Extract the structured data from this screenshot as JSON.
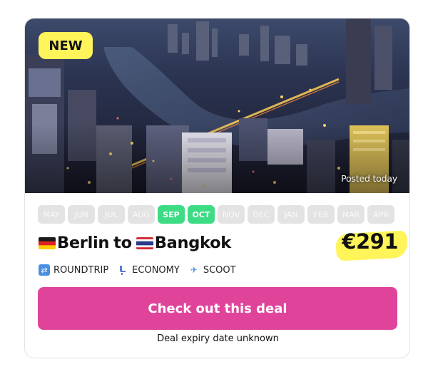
{
  "deal": {
    "badge": "NEW",
    "posted": "Posted today",
    "months": [
      {
        "label": "MAY",
        "active": false
      },
      {
        "label": "JUN",
        "active": false
      },
      {
        "label": "JUL",
        "active": false
      },
      {
        "label": "AUG",
        "active": false
      },
      {
        "label": "SEP",
        "active": true
      },
      {
        "label": "OCT",
        "active": true
      },
      {
        "label": "NOV",
        "active": false
      },
      {
        "label": "DEC",
        "active": false
      },
      {
        "label": "JAN",
        "active": false
      },
      {
        "label": "FEB",
        "active": false
      },
      {
        "label": "MAR",
        "active": false
      },
      {
        "label": "APR",
        "active": false
      }
    ],
    "origin": "Berlin",
    "connector": "to",
    "destination": "Bangkok",
    "origin_flag_icon": "germany-flag-icon",
    "destination_flag_icon": "thailand-flag-icon",
    "price": "€291",
    "tags": {
      "trip_type": "ROUNDTRIP",
      "cabin": "ECONOMY",
      "airline": "SCOOT"
    },
    "cta_label": "Check out this deal",
    "expiry": "Deal expiry date unknown"
  },
  "colors": {
    "badge_bg": "#fff45a",
    "month_active": "#3ddc84",
    "month_inactive": "#e3e3e3",
    "cta_bg": "#e0449a",
    "price_highlight": "#fff45a"
  }
}
